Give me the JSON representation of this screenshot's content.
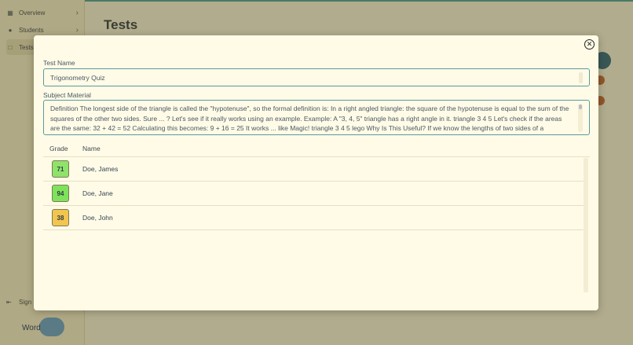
{
  "sidebar": {
    "items": [
      {
        "label": "Overview",
        "icon": "calendar-icon"
      },
      {
        "label": "Students",
        "icon": "people-icon"
      },
      {
        "label": "Tests",
        "icon": "document-icon"
      }
    ],
    "signout_label": "Sign",
    "logo_text": "Word"
  },
  "page": {
    "title": "Tests"
  },
  "modal": {
    "test_name_label": "Test Name",
    "test_name_value": "Trigonometry Quiz",
    "subject_label": "Subject Material",
    "subject_value": "Definition The longest side of the triangle is called the \"hypotenuse\", so the formal definition is: In a right angled triangle: the square of the hypotenuse is equal to the sum of the squares of the other two sides. Sure ... ? Let's see if it really works using an example. Example: A \"3, 4, 5\" triangle has a right angle in it. triangle 3 4 5 Let's check if the areas are the same: 32 + 42 = 52 Calculating this becomes: 9 + 16 = 25 It works ... like Magic! triangle 3 4 5 lego Why Is This Useful? If we know the lengths of two sides of a",
    "close_icon": "close-circle-icon",
    "columns": {
      "grade": "Grade",
      "name": "Name"
    },
    "rows": [
      {
        "grade": "71",
        "name": "Doe, James",
        "color": "#8fe36a"
      },
      {
        "grade": "94",
        "name": "Doe, Jane",
        "color": "#7ee35a"
      },
      {
        "grade": "38",
        "name": "Doe, John",
        "color": "#f2c54e"
      }
    ]
  }
}
